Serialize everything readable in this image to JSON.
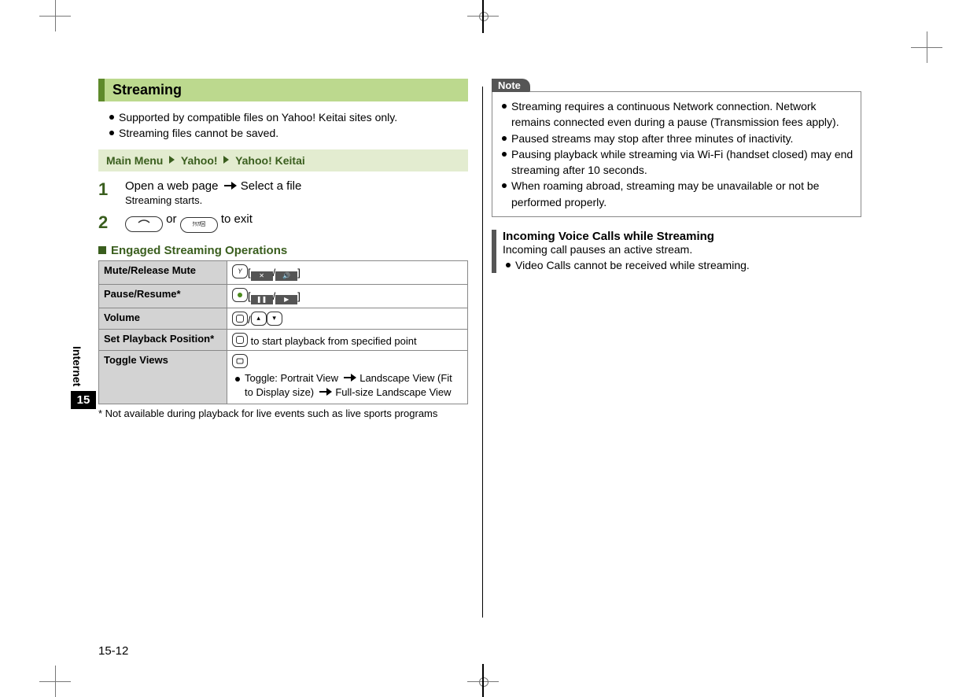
{
  "side": {
    "label": "Internet",
    "chapter": "15"
  },
  "page_number": "15-12",
  "left": {
    "heading": "Streaming",
    "bullets": [
      "Supported by compatible files on Yahoo! Keitai sites only.",
      "Streaming files cannot be saved."
    ],
    "nav": {
      "a": "Main Menu",
      "b": "Yahoo!",
      "c": "Yahoo! Keitai"
    },
    "step1_num": "1",
    "step1_a": "Open a web page",
    "step1_b": "Select a file",
    "step1_sub": "Streaming starts.",
    "step2_num": "2",
    "step2_mid": " or ",
    "step2_end": " to exit",
    "sub_heading": "Engaged Streaming Operations",
    "table": {
      "r1h": "Mute/Release Mute",
      "r2h": "Pause/Resume*",
      "r3h": "Volume",
      "r4h": "Set Playback Position*",
      "r4v": " to start playback from specified point",
      "r5h": "Toggle Views",
      "r5b1": "Toggle: Portrait View ",
      "r5b2": " Landscape View (Fit to Display size) ",
      "r5b3": " Full-size Landscape View"
    },
    "footnote": "* Not available during playback for live events such as live sports programs"
  },
  "right": {
    "note_label": "Note",
    "notes": [
      "Streaming requires a continuous Network connection. Network remains connected even during a pause (Transmission fees apply).",
      "Paused streams may stop after three minutes of inactivity.",
      "Pausing playback while streaming via Wi-Fi (handset closed) may end streaming after 10 seconds.",
      "When roaming abroad, streaming may be unavailable or not be performed properly."
    ],
    "info_title": "Incoming Voice Calls while Streaming",
    "info_sub": "Incoming call pauses an active stream.",
    "info_bullet": "Video Calls cannot be received while streaming."
  }
}
